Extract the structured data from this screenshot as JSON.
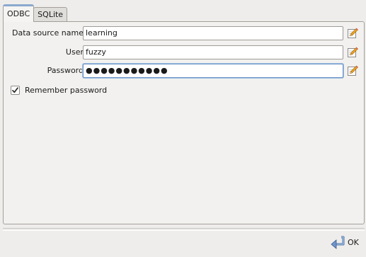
{
  "tabs": [
    {
      "label": "ODBC",
      "active": true
    },
    {
      "label": "SQLite",
      "active": false
    }
  ],
  "form": {
    "datasource": {
      "label": "Data source name",
      "value": "learning"
    },
    "user": {
      "label": "User",
      "value": "fuzzy"
    },
    "password": {
      "label": "Password",
      "value": "●●●●●●●●●●●"
    },
    "remember": {
      "label": "Remember password",
      "checked": true
    }
  },
  "icons": {
    "edit": "pencil-edit-icon",
    "ok": "enter-arrow-icon"
  },
  "footer": {
    "ok_label": "OK"
  },
  "colors": {
    "window_bg": "#efedeb",
    "active_tab_accent": "#8aa9cf",
    "focus_border": "#6b93c4"
  }
}
